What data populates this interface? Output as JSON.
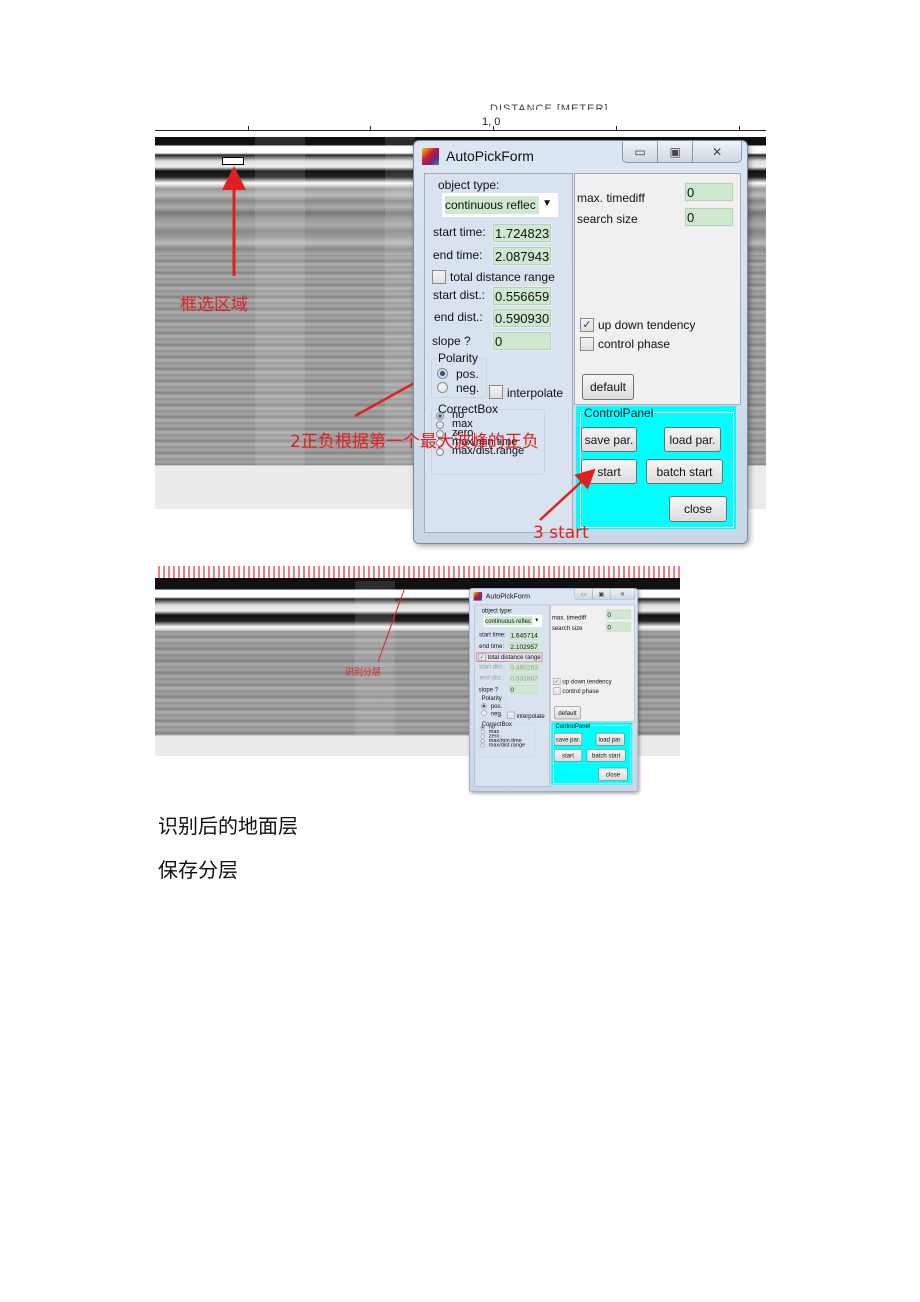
{
  "figure1": {
    "axis_title": "DISTANCE [METER]",
    "axis_tick_label": "1, 0",
    "annotations": {
      "box_select": "框选区域",
      "polarity_note": "2正负根据第一个最大波峰的正负",
      "start_note": "3 start"
    },
    "annotation_color": "#e02020"
  },
  "dialog1": {
    "title": "AutoPickForm",
    "window_buttons": {
      "minimize": "▭",
      "maximize": "▣",
      "close": "✕"
    },
    "object_type_label": "object type:",
    "object_type_value": "continuous reflec",
    "start_time_label": "start time:",
    "start_time": "1.724823",
    "end_time_label": "end time:",
    "end_time": "2.087943",
    "total_distance_label": "total distance range",
    "total_distance_checked": false,
    "start_dist_label": "start dist.:",
    "start_dist": "0.556659",
    "end_dist_label": "end dist.:",
    "end_dist": "0.590930",
    "slope_label": "slope ?",
    "slope": "0",
    "polarity_label": "Polarity",
    "polarity_options": [
      "pos.",
      "neg."
    ],
    "polarity_selected": "pos.",
    "interpolate_label": "interpolate",
    "correctbox_label": "CorrectBox",
    "correctbox_options": [
      "no",
      "max",
      "zero",
      "max/min.time",
      "max/dist.range"
    ],
    "correctbox_selected": "no",
    "max_timediff_label": "max. timediff",
    "max_timediff": "0",
    "search_size_label": "search size",
    "search_size": "0",
    "up_down_label": "up down tendency",
    "up_down_checked": true,
    "control_phase_label": "control phase",
    "control_phase_checked": false,
    "default_label": "default",
    "control_panel_label": "ControlPanel",
    "control_panel_color": "#00ffff",
    "save_par_label": "save par.",
    "load_par_label": "load par.",
    "start_label": "start",
    "batch_start_label": "batch start",
    "close_label": "close"
  },
  "figure2": {
    "annotation": "识别分层"
  },
  "dialog2": {
    "title": "AutoPickForm",
    "window_buttons": {
      "minimize": "▭",
      "maximize": "▣",
      "close": "✕"
    },
    "object_type_label": "object type:",
    "object_type_value": "continuous reflec",
    "start_time_label": "start time:",
    "start_time": "1.645714",
    "end_time_label": "end time:",
    "end_time": "2.102957",
    "total_distance_label": "total distance range",
    "total_distance_checked": true,
    "start_dist_label": "start dist.:",
    "start_dist": "0.480263",
    "end_dist_label": "end dist.:",
    "end_dist": "0.531887",
    "slope_label": "slope ?",
    "slope": "0",
    "polarity_label": "Polarity",
    "polarity_options": [
      "pos.",
      "neg."
    ],
    "polarity_selected": "pos.",
    "interpolate_label": "interpolate",
    "correctbox_label": "CorrectBox",
    "correctbox_options": [
      "no",
      "max",
      "zero",
      "max/min.time",
      "max/dist.range"
    ],
    "correctbox_selected": "no",
    "max_timediff_label": "max. timediff",
    "max_timediff": "0",
    "search_size_label": "search size",
    "search_size": "0",
    "up_down_label": "up down tendency",
    "up_down_checked": true,
    "control_phase_label": "control phase",
    "control_phase_checked": false,
    "default_label": "default",
    "control_panel_label": "ControlPanel",
    "control_panel_color": "#00ffff",
    "save_par_label": "save par.",
    "load_par_label": "load par.",
    "start_label": "start",
    "batch_start_label": "batch start",
    "close_label": "close"
  },
  "paragraphs": [
    "识别后的地面层",
    "保存分层"
  ]
}
